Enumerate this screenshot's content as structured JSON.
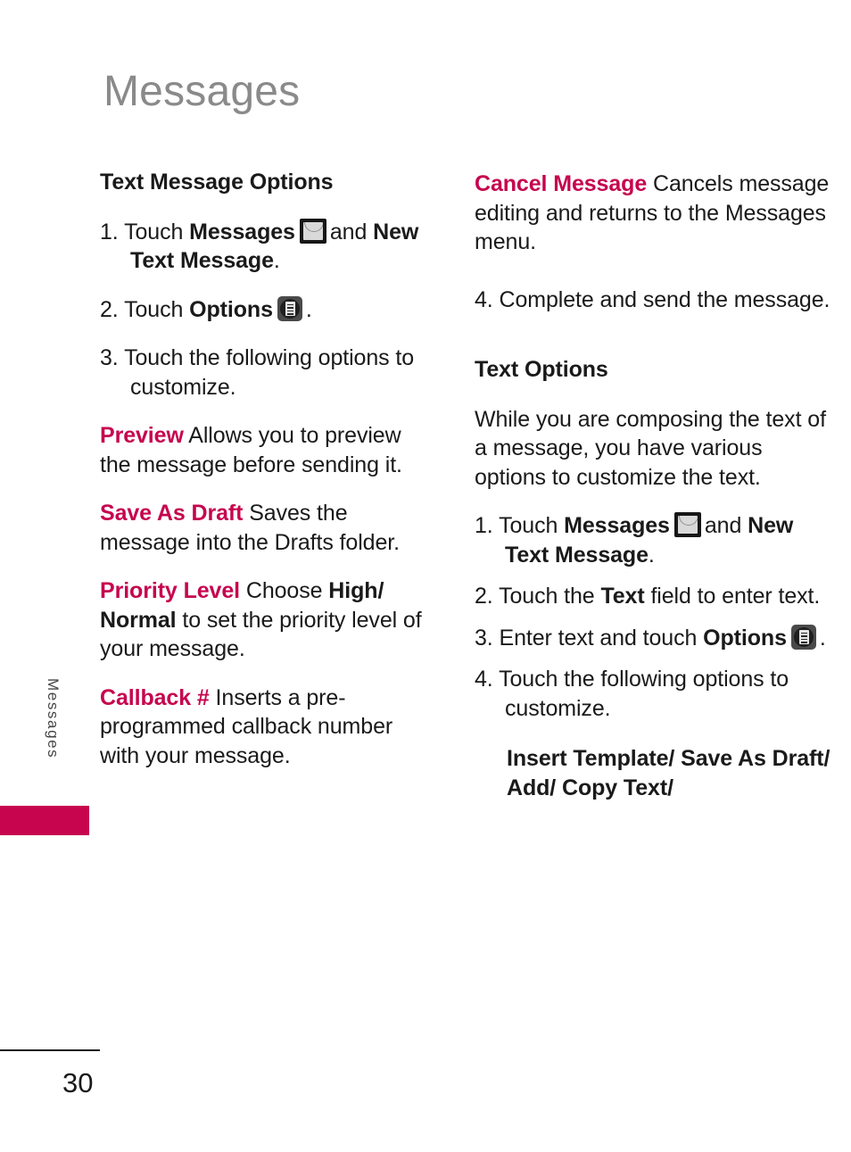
{
  "page": {
    "chapter_title": "Messages",
    "side_tab_label": "Messages",
    "page_number": "30",
    "accent_color": "#c6054e",
    "title_color": "#8a8a8a",
    "body_color": "#1a1a1a"
  },
  "icons": {
    "messages": "envelope-icon",
    "options": "options-list-icon"
  },
  "left_column": {
    "heading": "Text Message Options",
    "step1": {
      "number": "1.",
      "text_before": "Touch",
      "bold_1": "Messages",
      "text_middle": "and",
      "bold_2": "New Text Message",
      "text_after": "."
    },
    "step2": {
      "number": "2.",
      "text_before": "Touch",
      "bold_1": "Options",
      "text_after": "."
    },
    "step3": {
      "number": "3.",
      "text": "Touch the following options to customize."
    },
    "options": [
      {
        "term": "Preview",
        "description": "Allows you to preview the message before sending it."
      },
      {
        "term": "Save As Draft",
        "description": "Saves the message into the Drafts folder."
      },
      {
        "term": "Priority Level",
        "description_before": "Choose",
        "bold_value": "High/ Normal",
        "description_after": "to set the priority level of your message."
      },
      {
        "term": "Callback #",
        "description": "Inserts a pre-programmed callback number with your message."
      }
    ]
  },
  "right_column": {
    "cancel_option": {
      "term": "Cancel Message",
      "description": "Cancels message editing and returns to the Messages menu."
    },
    "step4": {
      "number": "4.",
      "text": "Complete and send the message."
    },
    "heading": "Text Options",
    "intro": "While you are composing the text of a message, you have various options to customize the text.",
    "step1": {
      "number": "1.",
      "text_before": "Touch",
      "bold_1": "Messages",
      "text_middle": "and",
      "bold_2": "New Text Message",
      "text_after": "."
    },
    "step2": {
      "number": "2.",
      "text_before": "Touch the",
      "bold_1": "Text",
      "text_after": "field to enter text."
    },
    "step3": {
      "number": "3.",
      "text_before": "Enter text and touch",
      "bold_1": "Options",
      "text_after": "."
    },
    "step4b": {
      "number": "4.",
      "text": "Touch the following options to customize."
    },
    "options_list": "Insert Template/ Save As Draft/ Add/ Copy Text/"
  }
}
